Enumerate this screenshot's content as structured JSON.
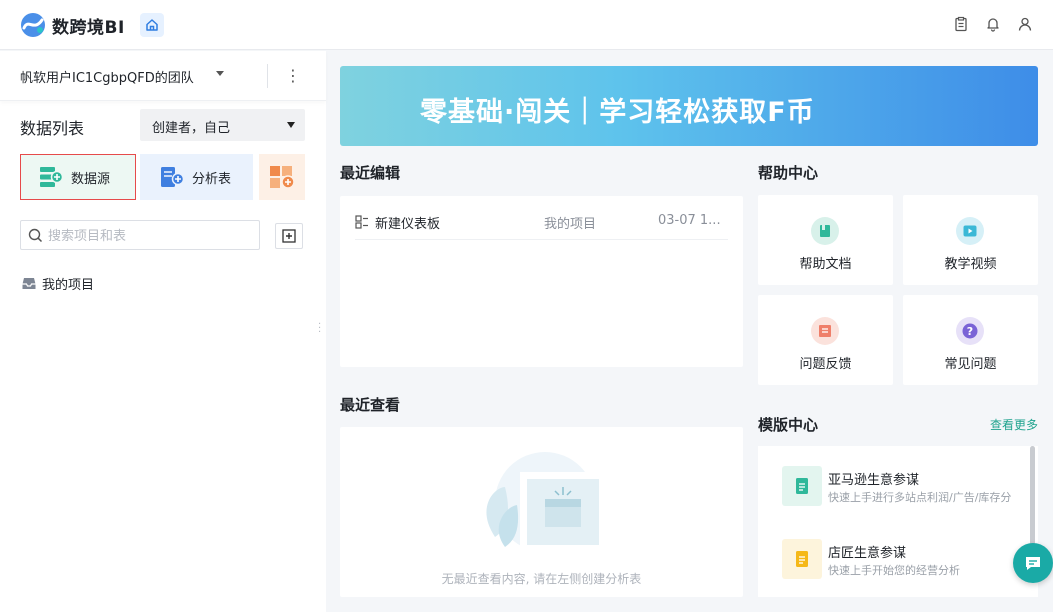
{
  "app": {
    "name": "数跨境BI"
  },
  "header": {
    "icons": [
      "home-icon",
      "clipboard-icon",
      "bell-icon",
      "user-icon"
    ]
  },
  "sidebar": {
    "team_name": "帆软用户IC1CgbpQFD的团队",
    "list_title": "数据列表",
    "creator_filter": "创建者，自己",
    "buttons": {
      "datasource": "数据源",
      "analysis": "分析表"
    },
    "search_placeholder": "搜索项目和表",
    "project": "我的项目"
  },
  "banner": {
    "text": "零基础·闯关｜学习轻松获取F币"
  },
  "recent_edit": {
    "title": "最近编辑",
    "rows": [
      {
        "name": "新建仪表板",
        "project": "我的项目",
        "time": "03-07 1..."
      }
    ]
  },
  "recent_view": {
    "title": "最近查看",
    "empty_text": "无最近查看内容, 请在左侧创建分析表"
  },
  "help_center": {
    "title": "帮助中心",
    "items": [
      {
        "label": "帮助文档",
        "icon": "document-icon",
        "color": "#2fb89a"
      },
      {
        "label": "教学视频",
        "icon": "video-icon",
        "color": "#3ab8d6"
      },
      {
        "label": "问题反馈",
        "icon": "feedback-icon",
        "color": "#ef7f6a"
      },
      {
        "label": "常见问题",
        "icon": "question-icon",
        "color": "#7a63d6"
      }
    ]
  },
  "template_center": {
    "title": "模版中心",
    "see_more": "查看更多",
    "items": [
      {
        "title": "亚马逊生意参谋",
        "subtitle": "快速上手进行多站点利润/广告/库存分",
        "color": "#2fb89a"
      },
      {
        "title": "店匠生意参谋",
        "subtitle": "快速上手开始您的经营分析",
        "color": "#f5b818"
      }
    ]
  },
  "colors": {
    "accent": "#1fa38e",
    "highlight_border": "#e64a4a"
  }
}
